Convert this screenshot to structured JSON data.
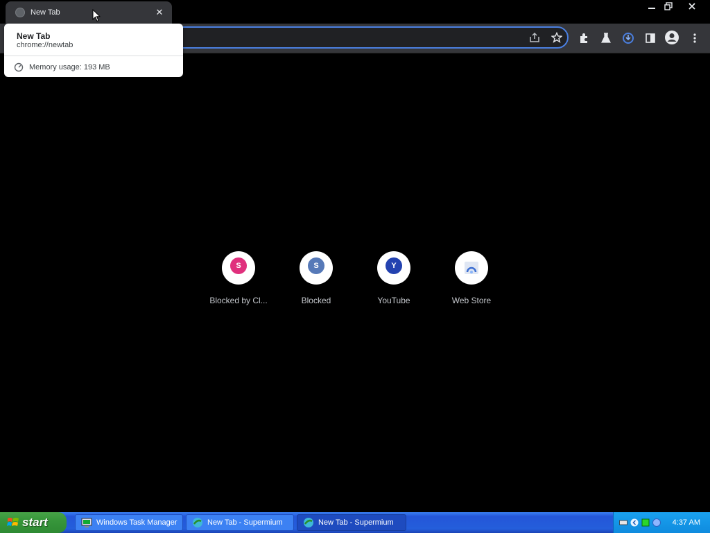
{
  "browser": {
    "tab": {
      "title": "New Tab",
      "close_glyph": "✕",
      "favicon": "globe-icon"
    },
    "window_controls": {
      "minimize": "—",
      "restore": "❐",
      "close": "✕"
    },
    "toolbar_icons": [
      "share-icon",
      "bookmark-star-icon",
      "extensions-icon",
      "labs-icon",
      "download-icon",
      "side-panel-icon",
      "profile-icon",
      "menu-icon"
    ],
    "accent_color": "#4a7fe0"
  },
  "hover_card": {
    "title": "New Tab",
    "url": "chrome://newtab",
    "memory": "Memory usage: 193 MB"
  },
  "shortcuts": [
    {
      "letter": "S",
      "label": "Blocked by Cl...",
      "color": "#e0307d"
    },
    {
      "letter": "S",
      "label": "Blocked",
      "color": "#5679b8"
    },
    {
      "letter": "Y",
      "label": "YouTube",
      "color": "#2342b0"
    },
    {
      "letter": "",
      "label": "Web Store",
      "color": "#d5def0"
    }
  ],
  "taskbar": {
    "start_label": "start",
    "tasks": [
      {
        "label": "Windows Task Manager",
        "active": false
      },
      {
        "label": "New Tab - Supermium",
        "active": false
      },
      {
        "label": "New Tab - Supermium",
        "active": true
      }
    ],
    "clock": "4:37 AM"
  }
}
